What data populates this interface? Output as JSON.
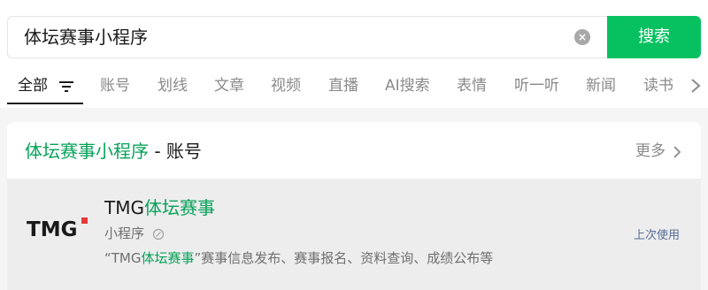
{
  "search": {
    "query": "体坛赛事小程序",
    "button_label": "搜索"
  },
  "tabs": [
    {
      "label": "全部",
      "active": true
    },
    {
      "label": "账号"
    },
    {
      "label": "划线"
    },
    {
      "label": "文章"
    },
    {
      "label": "视频"
    },
    {
      "label": "直播"
    },
    {
      "label": "AI搜索"
    },
    {
      "label": "表情"
    },
    {
      "label": "听一听"
    },
    {
      "label": "新闻"
    },
    {
      "label": "读书"
    }
  ],
  "section": {
    "title_highlight": "体坛赛事小程序",
    "title_suffix": " - 账号",
    "more_label": "更多"
  },
  "result": {
    "logo_text": "TMG",
    "name_prefix": "TMG",
    "name_highlight": "体坛赛事",
    "type_label": "小程序",
    "desc_open": "“TMG",
    "desc_highlight": "体坛赛事",
    "desc_rest": "”赛事信息发布、赛事报名、资料查询、成绩公布等",
    "last_used_label": "上次使用"
  },
  "colors": {
    "accent": "#07c160",
    "highlight": "#07a25a",
    "link": "#576b95",
    "logo_red": "#e4393c"
  },
  "icons": [
    "clear-icon",
    "filter-icon",
    "chevron-right-icon",
    "verified-icon"
  ]
}
